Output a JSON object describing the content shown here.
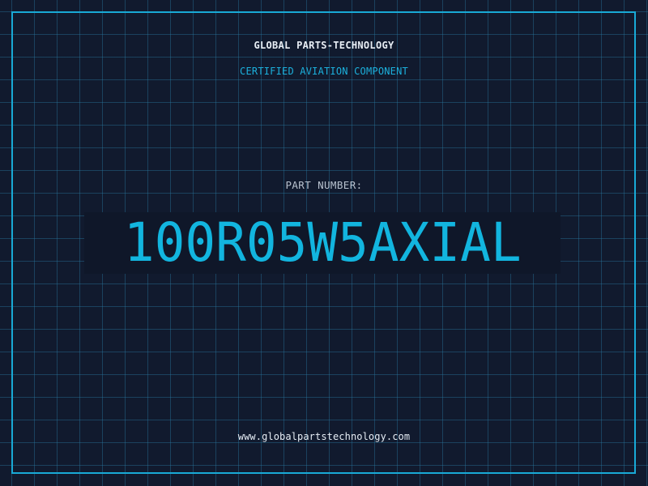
{
  "header": {
    "company": "GLOBAL PARTS-TECHNOLOGY",
    "certification": "CERTIFIED AVIATION COMPONENT"
  },
  "part": {
    "label": "PART NUMBER:",
    "number": "100R05W5AXIAL"
  },
  "footer": {
    "website": "www.globalpartstechnology.com"
  },
  "colors": {
    "background": "#111a2e",
    "grid": "#2878a0",
    "accent": "#12b5df",
    "frame": "#19a9d6",
    "text_primary": "#e8eef5",
    "text_muted": "#b8c2cf"
  }
}
